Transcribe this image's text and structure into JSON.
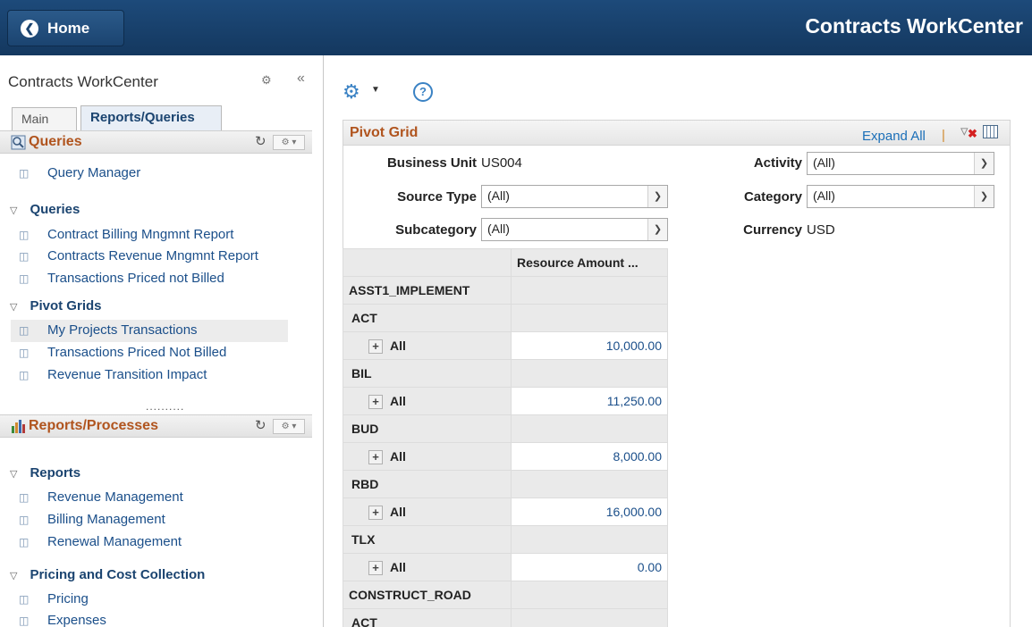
{
  "header": {
    "home_label": "Home",
    "app_title": "Contracts WorkCenter"
  },
  "left_panel": {
    "title": "Contracts WorkCenter",
    "tabs": [
      {
        "label": "Main",
        "active": false
      },
      {
        "label": "Reports/Queries",
        "active": true
      }
    ],
    "queries_section": {
      "title": "Queries",
      "links": [
        "Query Manager"
      ],
      "groups": [
        {
          "label": "Queries",
          "items": [
            "Contract Billing Mngmnt Report",
            "Contracts Revenue Mngmnt Report",
            "Transactions Priced not Billed"
          ]
        },
        {
          "label": "Pivot Grids",
          "items": [
            "My Projects Transactions",
            "Transactions Priced Not Billed",
            "Revenue Transition Impact"
          ]
        }
      ],
      "selected_item": "My Projects Transactions"
    },
    "splitter": "..........",
    "reports_section": {
      "title": "Reports/Processes",
      "groups": [
        {
          "label": "Reports",
          "items": [
            "Revenue Management",
            "Billing Management",
            "Renewal Management"
          ]
        },
        {
          "label": "Pricing and Cost Collection",
          "items": [
            "Pricing",
            "Expenses"
          ]
        }
      ]
    }
  },
  "pivot": {
    "title": "Pivot Grid",
    "expand_all": "Expand All",
    "separator": "|",
    "filters": {
      "business_unit": {
        "label": "Business Unit",
        "value": "US004"
      },
      "source_type": {
        "label": "Source Type",
        "value": "(All)"
      },
      "subcategory": {
        "label": "Subcategory",
        "value": "(All)"
      },
      "activity": {
        "label": "Activity",
        "value": "(All)"
      },
      "category": {
        "label": "Category",
        "value": "(All)"
      },
      "currency": {
        "label": "Currency",
        "value": "USD"
      }
    },
    "column_header": "Resource Amount ...",
    "rows": [
      {
        "label": "ASST1_IMPLEMENT",
        "level": 1
      },
      {
        "label": "ACT",
        "level": 2
      },
      {
        "label": "All",
        "level": 3,
        "value": "10,000.00"
      },
      {
        "label": "BIL",
        "level": 2
      },
      {
        "label": "All",
        "level": 3,
        "value": "11,250.00"
      },
      {
        "label": "BUD",
        "level": 2
      },
      {
        "label": "All",
        "level": 3,
        "value": "8,000.00"
      },
      {
        "label": "RBD",
        "level": 2
      },
      {
        "label": "All",
        "level": 3,
        "value": "16,000.00"
      },
      {
        "label": "TLX",
        "level": 2
      },
      {
        "label": "All",
        "level": 3,
        "value": "0.00"
      },
      {
        "label": "CONSTRUCT_ROAD",
        "level": 1
      },
      {
        "label": "ACT",
        "level": 2
      }
    ]
  },
  "icons": {
    "back": "chevron-left-icon",
    "gear": "gear-icon",
    "collapse": "double-chevron-left-icon",
    "refresh": "refresh-icon",
    "help": "help-icon",
    "filter_clear": "filter-clear-icon",
    "grid": "grid-view-icon",
    "expand": "plus-icon"
  },
  "colors": {
    "header_bg": "#1b4470",
    "section_title": "#b0541e",
    "link": "#1b4f8a"
  }
}
